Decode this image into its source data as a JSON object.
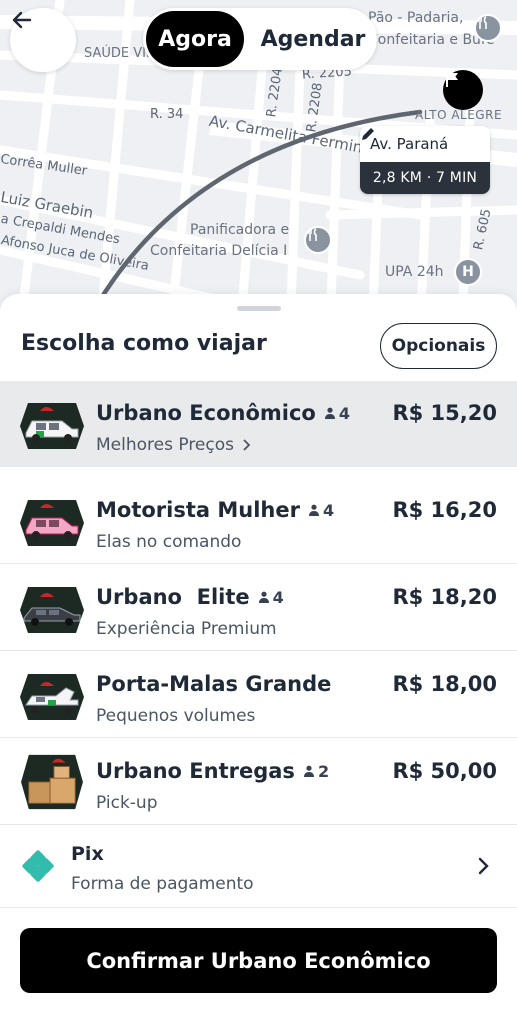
{
  "header": {
    "toggle_now": "Agora",
    "toggle_schedule": "Agendar"
  },
  "map": {
    "labels": {
      "padaria": "Pão - Padaria,",
      "padaria2": "Confeitaria e Bufê",
      "saude_vila": "SAÚDE VILA",
      "panificadora1": "Panificadora e",
      "panificadora2": "Confeitaria Delícia I",
      "upa": "UPA 24h",
      "alto_alegre": "ALTO ALEGRE"
    },
    "streets": {
      "r34": "R. 34",
      "av_carmelita": "Av. Carmelita Fermina",
      "r2204": "R. 2204",
      "r2208": "R. 2208",
      "r2205": "R. 2205",
      "correa_muller": "Corrêa Muller",
      "luiz_graebin": "Luiz Graebin",
      "crepaldi": "a Crepaldi Mendes",
      "afonso": "Afonso Juca de Oliveira",
      "r605": "R. 605"
    },
    "destination": {
      "name": "Av. Paraná",
      "distance_time": "2,8 KM · 7 MIN"
    },
    "colors": {
      "background": "#eef0f3",
      "road": "#ffffff",
      "route": "#5f6670"
    }
  },
  "sheet": {
    "title": "Escolha como viajar",
    "options_button": "Opcionais"
  },
  "rides": [
    {
      "name": "Urbano Econômico",
      "seats": "4",
      "subtitle": "Melhores Preços",
      "price": "R$ 15,20",
      "selected": true,
      "icon": "white-car-icon"
    },
    {
      "name": "Motorista Mulher",
      "seats": "4",
      "subtitle": "Elas no comando",
      "price": "R$ 16,20",
      "selected": false,
      "icon": "pink-car-icon"
    },
    {
      "name": "Urbano  Elite",
      "seats": "4",
      "subtitle": "Experiência Premium",
      "price": "R$ 18,20",
      "selected": false,
      "icon": "black-car-icon"
    },
    {
      "name": "Porta-Malas Grande",
      "seats": "",
      "subtitle": "Pequenos volumes",
      "price": "R$ 18,00",
      "selected": false,
      "icon": "open-trunk-car-icon"
    },
    {
      "name": "Urbano Entregas",
      "seats": "2",
      "subtitle": "Pick-up",
      "price": "R$ 50,00",
      "selected": false,
      "icon": "boxes-icon"
    }
  ],
  "payment": {
    "title": "Pix",
    "subtitle": "Forma de pagamento",
    "icon": "pix-icon",
    "color": "#32bcad"
  },
  "confirm_button": "Confirmar Urbano Econômico"
}
